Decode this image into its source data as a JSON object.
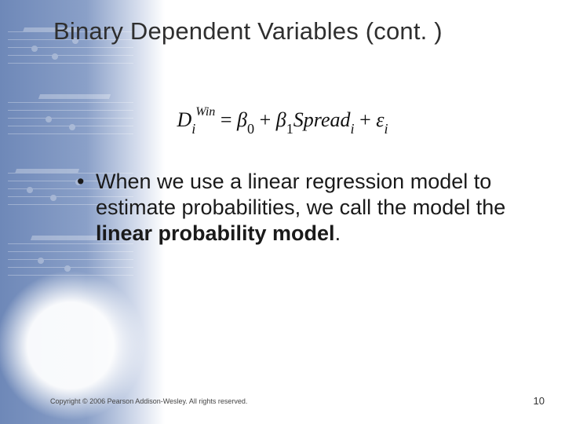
{
  "slide": {
    "title": "Binary Dependent Variables (cont. )",
    "equation": {
      "lhs_base": "D",
      "lhs_sub": "i",
      "lhs_sup": "Win",
      "eq": " = ",
      "b0_sym": "β",
      "b0_sub": "0",
      "plus1": " + ",
      "b1_sym": "β",
      "b1_sub": "1",
      "spread": "Spread",
      "spread_sub": "i",
      "plus2": " + ",
      "eps": "ε",
      "eps_sub": "i"
    },
    "bullet": {
      "marker": "•",
      "text_before": "When we use a linear regression model to estimate probabilities, we call the model the ",
      "bold": "linear probability model",
      "text_after": "."
    },
    "footer": "Copyright © 2006 Pearson Addison-Wesley. All rights reserved.",
    "page_number": "10"
  }
}
